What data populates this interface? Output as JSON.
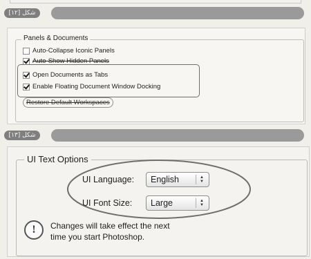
{
  "figure12": {
    "caption": "شكل [١٢]",
    "group_title": "Panels & Documents",
    "checkboxes": [
      {
        "label": "Auto-Collapse Iconic Panels",
        "checked": false,
        "strikethrough": false
      },
      {
        "label": "Auto-Show Hidden Panels",
        "checked": true,
        "strikethrough": true
      },
      {
        "label": "Open Documents as Tabs",
        "checked": true,
        "strikethrough": false
      },
      {
        "label": "Enable Floating Document Window Docking",
        "checked": true,
        "strikethrough": false
      }
    ],
    "restore_button": "Restore Default Workspaces"
  },
  "figure13": {
    "caption": "شكل [١٣]",
    "group_title": "UI Text Options",
    "language_label": "UI Language:",
    "language_value": "English",
    "font_size_label": "UI Font Size:",
    "font_size_value": "Large",
    "note_line1": "Changes will take effect the next",
    "note_line2": "time you start Photoshop."
  },
  "icons": {
    "warning": "exclamation-circle-icon",
    "stepper": "up-down-stepper-icon"
  },
  "colors": {
    "background": "#f1efe9",
    "caption_bar": "#9a9a9a",
    "caption_badge": "#7f7f7f",
    "highlight_stroke": "#6e6e6e"
  }
}
